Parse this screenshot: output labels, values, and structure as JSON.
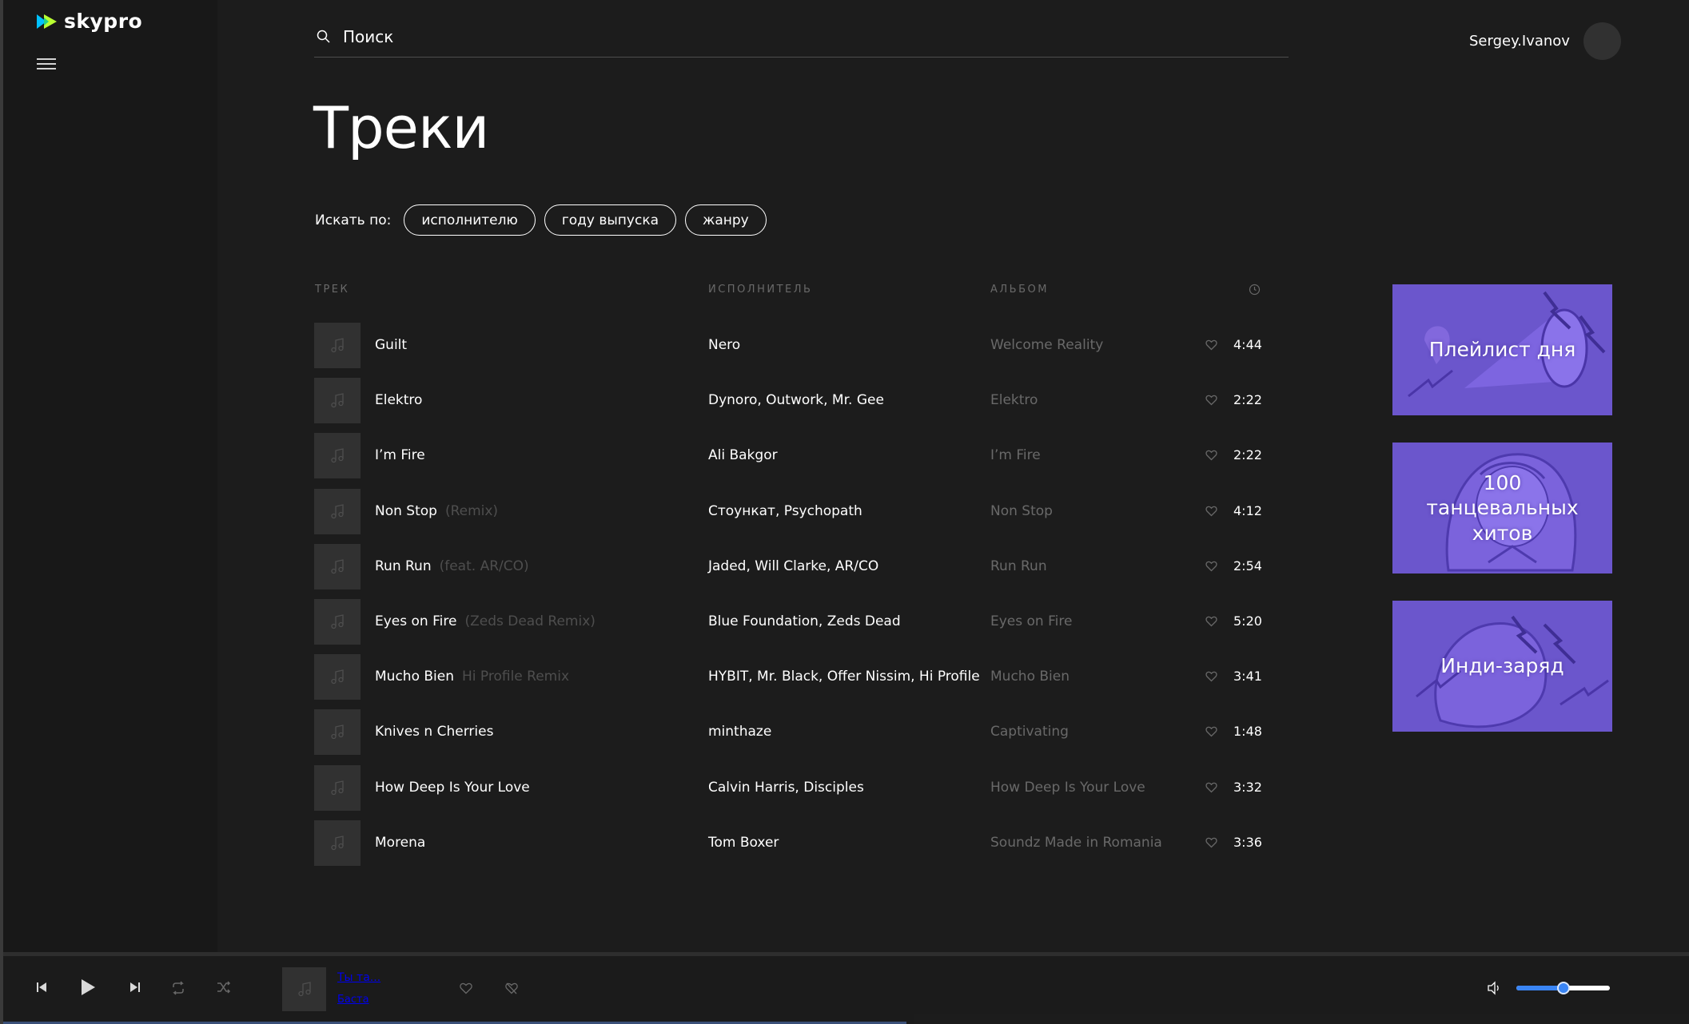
{
  "brand": {
    "logo_text": "skypro",
    "accent": "#b9ff31",
    "accent2": "#00c1ff"
  },
  "header": {
    "search_placeholder": "Поиск",
    "user_name": "Sergey.Ivanov"
  },
  "main": {
    "title": "Треки",
    "filter_label": "Искать по:",
    "filters": [
      "исполнителю",
      "году выпуска",
      "жанру"
    ],
    "columns": {
      "track": "ТРЕК",
      "author": "ИСПОЛНИТЕЛЬ",
      "album": "АЛЬБОМ",
      "time_icon": "clock-icon"
    },
    "tracks": [
      {
        "title": "Guilt",
        "sub": "",
        "author": "Nero",
        "album": "Welcome Reality",
        "time": "4:44"
      },
      {
        "title": "Elektro",
        "sub": "",
        "author": "Dynoro, Outwork, Mr. Gee",
        "album": "Elektro",
        "time": "2:22"
      },
      {
        "title": "I’m Fire",
        "sub": "",
        "author": "Ali Bakgor",
        "album": "I’m Fire",
        "time": "2:22"
      },
      {
        "title": "Non Stop",
        "sub": "(Remix)",
        "author": "Стоункат, Psychopath",
        "album": "Non Stop",
        "time": "4:12"
      },
      {
        "title": "Run Run",
        "sub": "(feat. AR/CO)",
        "author": "Jaded, Will Clarke, AR/CO",
        "album": "Run Run",
        "time": "2:54"
      },
      {
        "title": "Eyes on Fire",
        "sub": "(Zeds Dead Remix)",
        "author": "Blue Foundation, Zeds Dead",
        "album": "Eyes on Fire",
        "time": "5:20"
      },
      {
        "title": "Mucho Bien",
        "sub": "Hi Profile Remix",
        "author": "HYBIT, Mr. Black, Offer Nissim, Hi Profile",
        "album": "Mucho Bien",
        "time": "3:41"
      },
      {
        "title": "Knives n Cherries",
        "sub": "",
        "author": "minthaze",
        "album": "Captivating",
        "time": "1:48"
      },
      {
        "title": "How Deep Is Your Love",
        "sub": "",
        "author": "Calvin Harris, Disciples",
        "album": "How Deep Is Your Love",
        "time": "3:32"
      },
      {
        "title": "Morena",
        "sub": "",
        "author": "Tom Boxer",
        "album": "Soundz Made in Romania",
        "time": "3:36"
      }
    ]
  },
  "playlists": [
    {
      "label": "Плейлист дня",
      "icon": "megaphone-illustration"
    },
    {
      "label": "100 танцевальных хитов",
      "icon": "girl-illustration"
    },
    {
      "label": "Инди-заряд",
      "icon": "hand-lightning-illustration"
    }
  ],
  "player": {
    "track_title": "Ты та...",
    "track_author": "Баста",
    "controls": [
      "prev-icon",
      "play-icon",
      "next-icon",
      "repeat-icon",
      "shuffle-icon"
    ],
    "volume_percent": 50,
    "volume_color": "#3a85f4"
  }
}
